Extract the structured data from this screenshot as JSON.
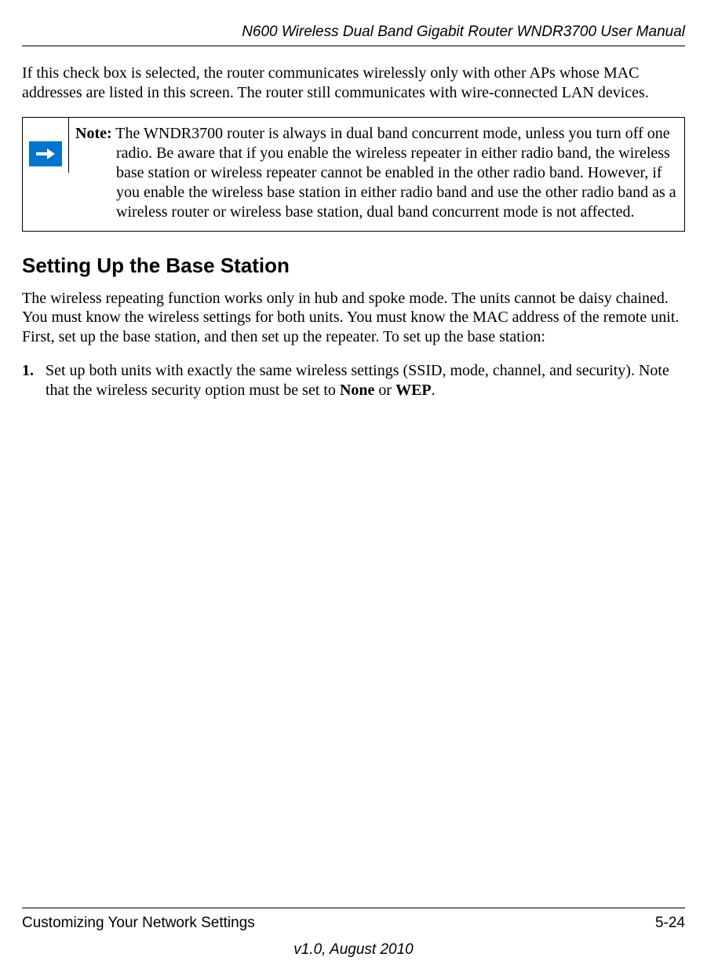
{
  "header": {
    "title": "N600 Wireless Dual Band Gigabit Router WNDR3700 User Manual"
  },
  "intro_para": "If this check box is selected, the router communicates wirelessly only with other APs whose MAC addresses are listed in this screen. The router still communicates with wire-connected LAN devices.",
  "note": {
    "label": "Note:",
    "text": " The WNDR3700 router is always in dual band concurrent mode, unless you turn off one radio. Be aware that if you enable the wireless repeater in either radio band, the wireless base station or wireless repeater cannot be enabled in the other radio band. However, if you enable the wireless base station in either radio band and use the other radio band as a wireless router or wireless base station, dual band concurrent mode is not affected."
  },
  "section": {
    "heading": "Setting Up the Base Station",
    "para": "The wireless repeating function works only in hub and spoke mode. The units cannot be daisy chained. You must know the wireless settings for both units. You must know the MAC address of the remote unit. First, set up the base station, and then set up the repeater. To set up the base station:",
    "step1": {
      "num": "1.",
      "pre": "Set up both units with exactly the same wireless settings (SSID, mode, channel, and security). Note that the wireless security option must be set to ",
      "bold1": "None",
      "mid": " or ",
      "bold2": "WEP",
      "post": "."
    }
  },
  "footer": {
    "left": "Customizing Your Network Settings",
    "right": "5-24",
    "version": "v1.0, August 2010"
  }
}
